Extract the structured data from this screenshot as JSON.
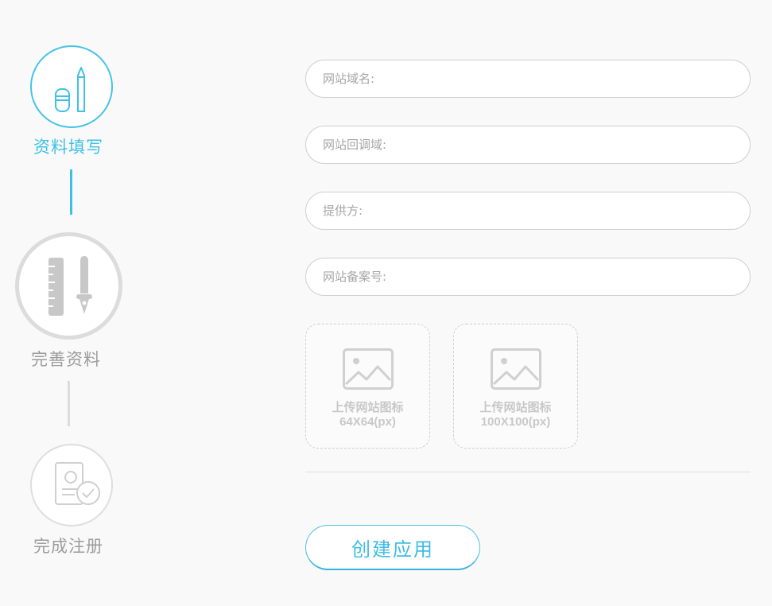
{
  "colors": {
    "active": "#3fc1e5",
    "inactive": "#d2d2d2",
    "inactive_text": "#9c9c9c",
    "field_border": "#cfcfd2",
    "placeholder": "#a6a6a6"
  },
  "steps": [
    {
      "label": "资料填写",
      "icon": "pencil-eraser-icon",
      "state": "active"
    },
    {
      "label": "完善资料",
      "icon": "ruler-pen-icon",
      "state": "current"
    },
    {
      "label": "完成注册",
      "icon": "document-check-icon",
      "state": "pending"
    }
  ],
  "form": {
    "fields": [
      {
        "placeholder": "网站域名:"
      },
      {
        "placeholder": "网站回调域:"
      },
      {
        "placeholder": "提供方:"
      },
      {
        "placeholder": "网站备案号:"
      }
    ],
    "uploads": [
      {
        "label": "上传网站图标",
        "size": "64X64(px)",
        "icon": "image-icon"
      },
      {
        "label": "上传网站图标",
        "size": "100X100(px)",
        "icon": "image-icon"
      }
    ],
    "submit_label": "创建应用"
  }
}
